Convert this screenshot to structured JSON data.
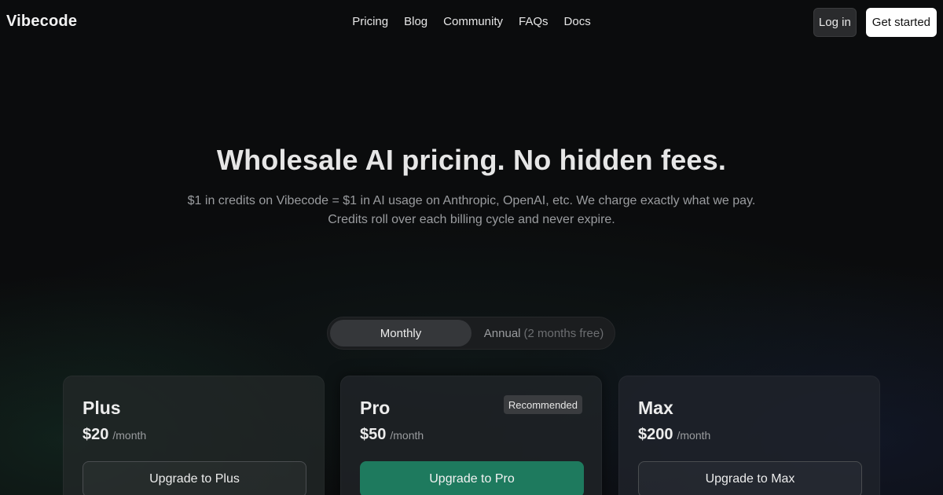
{
  "brand": {
    "name": "Vibecode"
  },
  "nav": {
    "items": [
      "Pricing",
      "Blog",
      "Community",
      "FAQs",
      "Docs"
    ]
  },
  "auth": {
    "login_label": "Log in",
    "get_started_label": "Get started"
  },
  "hero": {
    "title": "Wholesale AI pricing. No hidden fees.",
    "subtitle_line1": "$1 in credits on Vibecode = $1 in AI usage on Anthropic, OpenAI, etc. We charge exactly what we pay.",
    "subtitle_line2": "Credits roll over each billing cycle and never expire."
  },
  "billing_toggle": {
    "monthly_label": "Monthly",
    "annual_label": "Annual",
    "annual_note": "(2 months free)",
    "selected": "Monthly"
  },
  "plans": [
    {
      "name": "Plus",
      "price": "$20",
      "period": "/month",
      "button_label": "Upgrade to Plus",
      "badge": ""
    },
    {
      "name": "Pro",
      "price": "$50",
      "period": "/month",
      "button_label": "Upgrade to Pro",
      "badge": "Recommended"
    },
    {
      "name": "Max",
      "price": "$200",
      "period": "/month",
      "button_label": "Upgrade to Max",
      "badge": ""
    }
  ],
  "colors": {
    "background": "#0b0c0d",
    "accent_green": "#1e7a5e",
    "text_primary": "#ececec",
    "text_muted": "#9a9c9f"
  }
}
